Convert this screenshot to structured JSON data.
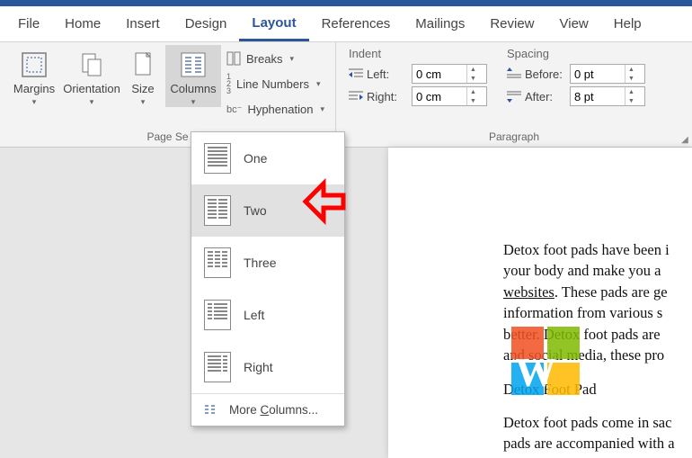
{
  "tabs": {
    "file": "File",
    "home": "Home",
    "insert": "Insert",
    "design": "Design",
    "layout": "Layout",
    "references": "References",
    "mailings": "Mailings",
    "review": "Review",
    "view": "View",
    "help": "Help"
  },
  "pagesetup": {
    "label": "Page Se",
    "margins": "Margins",
    "orientation": "Orientation",
    "size": "Size",
    "columns": "Columns",
    "breaks": "Breaks",
    "line_numbers": "Line Numbers",
    "hyphenation": "Hyphenation"
  },
  "paragraph": {
    "label": "Paragraph",
    "indent_hdr": "Indent",
    "spacing_hdr": "Spacing",
    "left_label": "Left:",
    "right_label": "Right:",
    "before_label": "Before:",
    "after_label": "After:",
    "left_val": "0 cm",
    "right_val": "0 cm",
    "before_val": "0 pt",
    "after_val": "8 pt"
  },
  "columns_menu": {
    "one": "One",
    "two": "Two",
    "three": "Three",
    "left": "Left",
    "right": "Right",
    "more": "More Columns..."
  },
  "doc": {
    "p1a": "Detox foot pads have been i",
    "p1b": "your body and make you a ",
    "p1c_link": "websites",
    "p1c_rest": ". These pads are ge",
    "p1d": "information from various s",
    "p1e": "better. Detox foot pads are",
    "p1f": "and social media, these pro",
    "p2": "Detox Foot Pad",
    "p3a": "Detox foot pads come in sac",
    "p3b": "pads are accompanied with a"
  }
}
